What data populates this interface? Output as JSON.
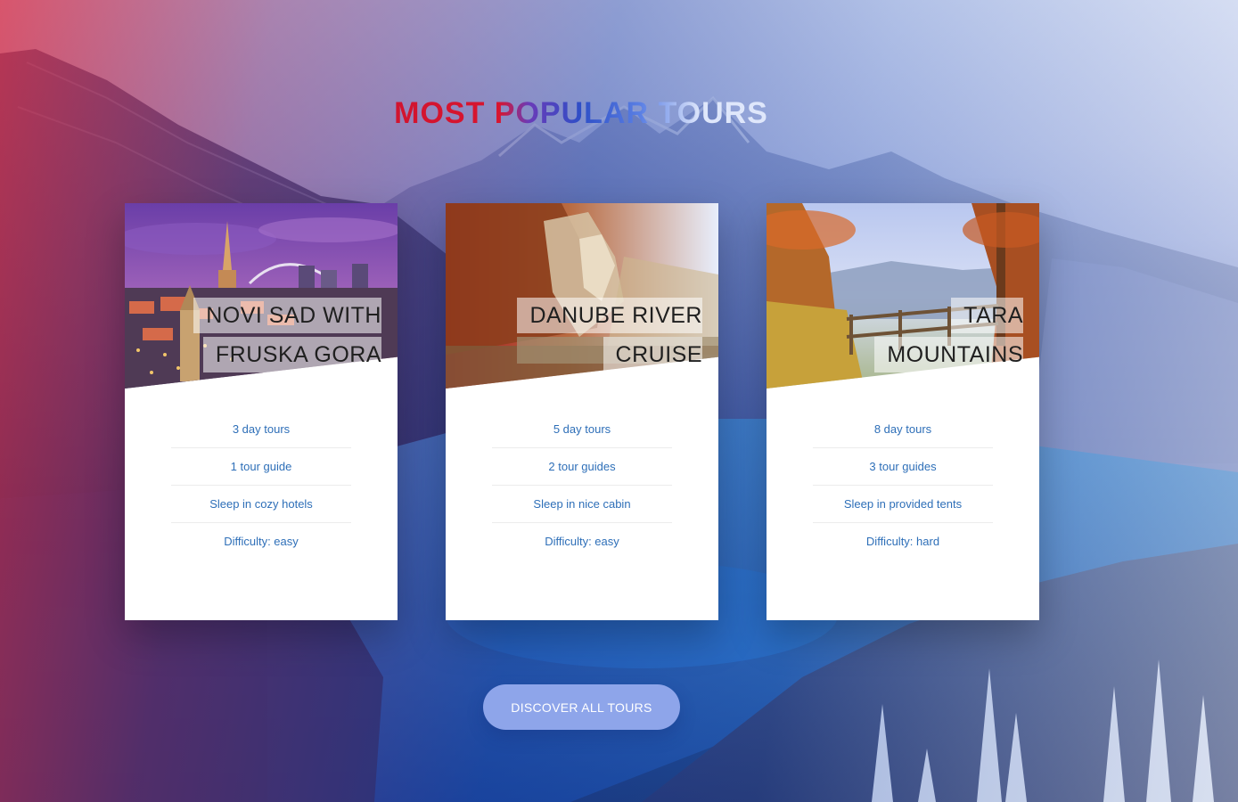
{
  "section": {
    "title": "Most popular tours"
  },
  "cards": [
    {
      "title_line1": "Novi Sad with",
      "title_line2": "Fruska Gora",
      "details": [
        "3 day tours",
        "1 tour guide",
        "Sleep in cozy hotels",
        "Difficulty: easy"
      ]
    },
    {
      "title_line1": "Danube River",
      "title_line2": "Cruise",
      "details": [
        "5 day tours",
        "2 tour guides",
        "Sleep in nice cabin",
        "Difficulty: easy"
      ]
    },
    {
      "title_line1": "Tara",
      "title_line2": "Mountains",
      "details": [
        "8 day tours",
        "3 tour guides",
        "Sleep in provided tents",
        "Difficulty: hard"
      ]
    }
  ],
  "cta": {
    "label": "Discover all tours"
  },
  "colors": {
    "heading_red": "#d1142f",
    "heading_blue": "#2e4fc7",
    "detail_text": "#2e6fb8",
    "button_bg": "#8ea5ea"
  }
}
